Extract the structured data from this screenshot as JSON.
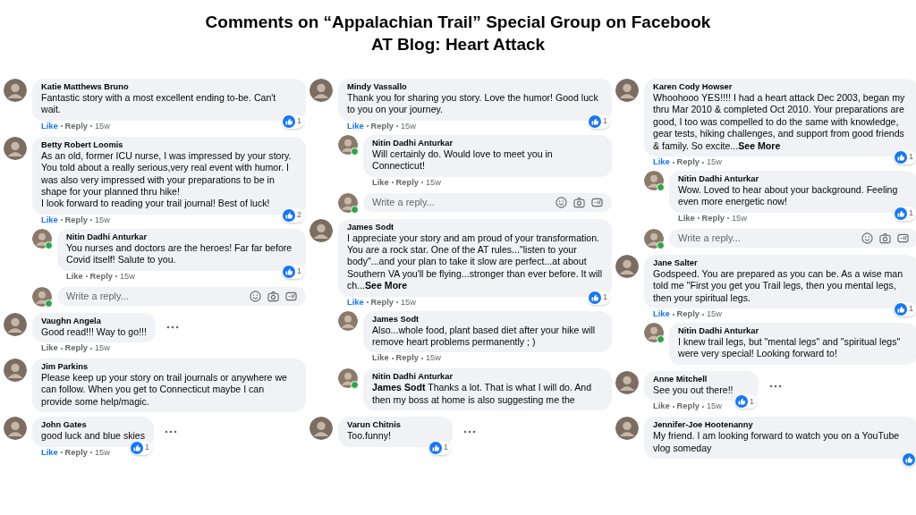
{
  "title": [
    "Comments on “Appalachian Trail” Special Group on Facebook",
    "AT Blog: Heart Attack"
  ],
  "columns": [
    {
      "items": [
        {
          "kind": "comment",
          "name": "Katie Matthews Bruno",
          "text": "Fantastic story with a most excellent ending to-be. Can't wait.",
          "reacted": true,
          "reactions": "1",
          "actions": {
            "like": "Like",
            "reply": "Reply",
            "time": "15w",
            "liked": true
          }
        },
        {
          "kind": "comment",
          "name": "Betty Robert Loomis",
          "text": "As an old, former ICU nurse, I was impressed by your story. You told about a really serious,very real event with humor. I was also very impressed with your preparations to be in shape for your planned thru hike!\nI look forward to reading your trail journal! Best of luck!",
          "reacted": true,
          "reactions": "2",
          "actions": {
            "like": "Like",
            "reply": "Reply",
            "time": "15w",
            "liked": true
          },
          "children": [
            {
              "kind": "comment",
              "name": "Nitin Dadhi Anturkar",
              "online": true,
              "text": "You nurses and doctors are the heroes! Far far before Covid itself! Salute to you.",
              "reacted": true,
              "reactions": "1",
              "actions": {
                "like": "Like",
                "reply": "Reply",
                "time": "15w",
                "liked": false
              }
            },
            {
              "kind": "reply_box",
              "placeholder": "Write a reply...",
              "online": true
            }
          ]
        },
        {
          "kind": "comment",
          "name": "Vaughn Angela",
          "text": "Good read!!! Way to go!!!",
          "more": true,
          "reacted": false,
          "actions": {
            "like": "Like",
            "reply": "Reply",
            "time": "15w",
            "liked": false
          }
        },
        {
          "kind": "comment",
          "name": "Jim Parkins",
          "text": "Please keep up your story on trail journals or anywhere we can follow. When you get to Connecticut maybe I can provide some help/magic.",
          "reacted": false
        },
        {
          "kind": "comment",
          "name": "John Gates",
          "text": "good luck and blue skies",
          "more": true,
          "reacted": true,
          "reactions": "1",
          "actions": {
            "like": "Like",
            "reply": "Reply",
            "time": "15w",
            "liked": true
          }
        }
      ]
    },
    {
      "items": [
        {
          "kind": "comment",
          "name": "Mindy Vassallo",
          "text": "Thank you for sharing you story. Love the humor! Good luck to you on your journey.",
          "reacted": true,
          "reactions": "1",
          "actions": {
            "like": "Like",
            "reply": "Reply",
            "time": "15w",
            "liked": true
          },
          "children": [
            {
              "kind": "comment",
              "name": "Nitin Dadhi Anturkar",
              "online": true,
              "text": "Will certainly do. Would love to meet you in Connecticut!",
              "reacted": false,
              "actions": {
                "like": "Like",
                "reply": "Reply",
                "time": "15w",
                "liked": false
              }
            },
            {
              "kind": "reply_box",
              "placeholder": "Write a reply...",
              "online": true
            }
          ]
        },
        {
          "kind": "comment",
          "name": "James Sodt",
          "text": "I appreciate your story and am proud of your transformation. You are a rock star. One of the AT rules...\"listen to your body\"...and your plan to take it slow are perfect...at about Southern VA you'll be flying...stronger than ever before. It will ch...",
          "see_more": "See More",
          "reacted": true,
          "reactions": "1",
          "actions": {
            "like": "Like",
            "reply": "Reply",
            "time": "15w",
            "liked": true
          },
          "children": [
            {
              "kind": "comment",
              "name": "James Sodt",
              "text": "Also...whole food, plant based diet after your hike will remove heart problems permanently ; )",
              "reacted": false,
              "actions": {
                "like": "Like",
                "reply": "Reply",
                "time": "15w",
                "liked": false
              }
            },
            {
              "kind": "comment",
              "name": "Nitin Dadhi Anturkar",
              "online": true,
              "text": "**James Sodt** Thanks a lot. That is what I will do. And then my boss at home is also suggesting me the",
              "reacted": false
            }
          ]
        },
        {
          "kind": "comment",
          "name": "Varun Chitnis",
          "text": "Too.funny!",
          "more": true,
          "reacted": true,
          "reactions": "1"
        }
      ]
    },
    {
      "items": [
        {
          "kind": "comment",
          "name": "Karen Cody Howser",
          "text": "Whoohooo YES!!!! I had a heart attack Dec 2003, began my thru Mar 2010 & completed Oct 2010. Your preparations are good, I too was compelled to do the same with knowledge, gear tests, hiking challenges, and support from good friends & family. So excite...",
          "see_more": "See More",
          "reacted": true,
          "reactions": "1",
          "actions": {
            "like": "Like",
            "reply": "Reply",
            "time": "15w",
            "liked": true
          },
          "children": [
            {
              "kind": "comment",
              "name": "Nitin Dadhi Anturkar",
              "online": true,
              "text": "Wow. Loved to hear about your background. Feeling even more energetic now!",
              "reacted": true,
              "reactions": "1",
              "actions": {
                "like": "Like",
                "reply": "Reply",
                "time": "15w",
                "liked": false
              }
            },
            {
              "kind": "reply_box",
              "placeholder": "Write a reply...",
              "online": true
            }
          ]
        },
        {
          "kind": "comment",
          "name": "Jane Salter",
          "text": "Godspeed. You are prepared as you can be. As a wise man told me \"First you get you Trail legs, then you mental legs, then your spiritual legs.",
          "reacted": true,
          "reactions": "1",
          "actions": {
            "like": "Like",
            "reply": "Reply",
            "time": "15w",
            "liked": true
          },
          "children": [
            {
              "kind": "comment",
              "name": "Nitin Dadhi Anturkar",
              "online": true,
              "text": "I knew trail legs, but \"mental legs\" and \"spiritual legs\" were very special! Looking forward to!",
              "reacted": false
            }
          ]
        },
        {
          "kind": "comment",
          "name": "Anne Mitchell",
          "text": "See you out there!!",
          "more": true,
          "reacted": true,
          "reactions": "1",
          "actions": {
            "like": "Like",
            "reply": "Reply",
            "time": "15w",
            "liked": false
          }
        },
        {
          "kind": "comment",
          "name": "Jennifer-Joe Hootenanny",
          "text": "My friend. I am looking forward to watch you on a YouTube vlog someday",
          "reacted": true
        }
      ]
    }
  ]
}
